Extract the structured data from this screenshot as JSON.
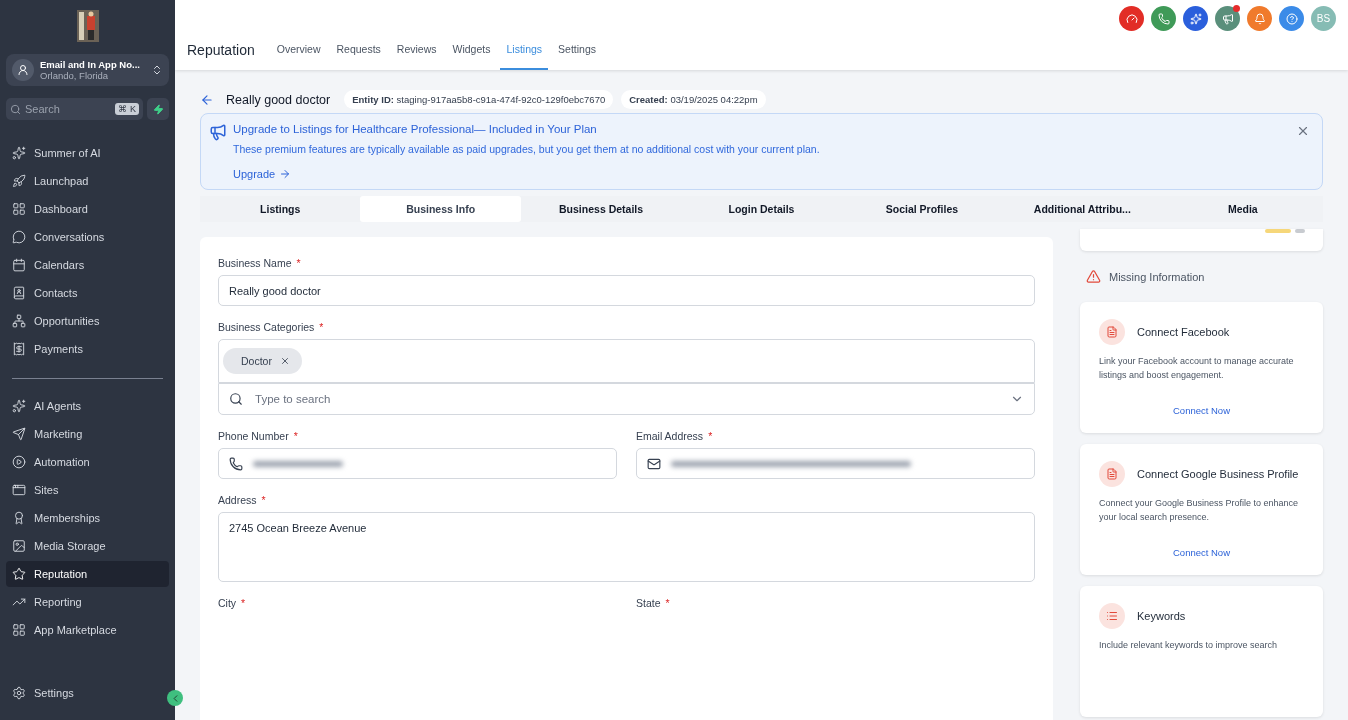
{
  "sidebar": {
    "account": {
      "name": "Email and In App No...",
      "location": "Orlando, Florida"
    },
    "search": {
      "placeholder": "Search",
      "shortcut": "⌘ K"
    },
    "items": [
      {
        "label": "Summer of AI",
        "selected": false
      },
      {
        "label": "Launchpad",
        "selected": false
      },
      {
        "label": "Dashboard",
        "selected": false
      },
      {
        "label": "Conversations",
        "selected": false
      },
      {
        "label": "Calendars",
        "selected": false
      },
      {
        "label": "Contacts",
        "selected": false
      },
      {
        "label": "Opportunities",
        "selected": false
      },
      {
        "label": "Payments",
        "selected": false
      }
    ],
    "items_2": [
      {
        "label": "AI Agents",
        "selected": false
      },
      {
        "label": "Marketing",
        "selected": false
      },
      {
        "label": "Automation",
        "selected": false
      },
      {
        "label": "Sites",
        "selected": false
      },
      {
        "label": "Memberships",
        "selected": false
      },
      {
        "label": "Media Storage",
        "selected": false
      },
      {
        "label": "Reputation",
        "selected": true
      },
      {
        "label": "Reporting",
        "selected": false
      },
      {
        "label": "App Marketplace",
        "selected": false
      }
    ],
    "footer": {
      "label": "Settings"
    }
  },
  "header": {
    "title": "Reputation",
    "tabs": [
      {
        "label": "Overview",
        "selected": false
      },
      {
        "label": "Requests",
        "selected": false
      },
      {
        "label": "Reviews",
        "selected": false
      },
      {
        "label": "Widgets",
        "selected": false
      },
      {
        "label": "Listings",
        "selected": true
      },
      {
        "label": "Settings",
        "selected": false
      }
    ],
    "avatar": "BS"
  },
  "entity": {
    "name": "Really good doctor",
    "meta": [
      {
        "label": "Entity ID:",
        "value": "staging-917aa5b8-c91a-474f-92c0-129f0ebc7670"
      },
      {
        "label": "Created:",
        "value": "03/19/2025 04:22pm"
      }
    ]
  },
  "banner": {
    "title": "Upgrade to Listings for Healthcare Professional— Included in Your Plan",
    "text": "These premium features are typically available as paid upgrades, but you get them at no additional cost with your current plan.",
    "action": "Upgrade"
  },
  "tabs": [
    {
      "label": "Listings",
      "selected": false
    },
    {
      "label": "Business Info",
      "selected": true
    },
    {
      "label": "Business Details",
      "selected": false
    },
    {
      "label": "Login Details",
      "selected": false
    },
    {
      "label": "Social Profiles",
      "selected": false
    },
    {
      "label": "Additional Attribu...",
      "selected": false
    },
    {
      "label": "Media",
      "selected": false
    }
  ],
  "form": {
    "business_name": {
      "label": "Business Name",
      "marker": "*",
      "value": "Really good doctor"
    },
    "categories": {
      "label": "Business Categories",
      "marker": "*",
      "chips": [
        "Doctor"
      ],
      "placeholder": "Type to search"
    },
    "phone": {
      "label": "Phone Number",
      "marker": "*"
    },
    "email": {
      "label": "Email Address",
      "marker": "*"
    },
    "address": {
      "label": "Address",
      "marker": "*",
      "value": "2745 Ocean Breeze Avenue"
    },
    "city": {
      "label": "City",
      "marker": "*"
    },
    "state": {
      "label": "State",
      "marker": "*"
    }
  },
  "missing": {
    "title": "Missing Information",
    "cards": [
      {
        "title": "Connect Facebook",
        "text": "Link your Facebook account to manage accurate listings and boost engagement.",
        "action": "Connect Now"
      },
      {
        "title": "Connect Google Business Profile",
        "text": "Connect your Google Business Profile to enhance your local search presence.",
        "action": "Connect Now"
      },
      {
        "title": "Keywords",
        "text": "Include relevant keywords to improve search"
      }
    ]
  }
}
